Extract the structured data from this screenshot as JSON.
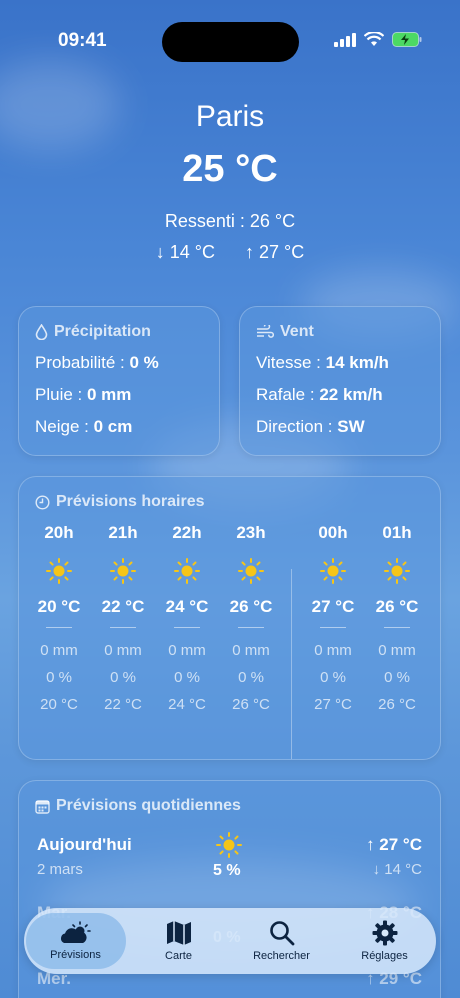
{
  "status": {
    "time": "09:41"
  },
  "header": {
    "city": "Paris",
    "temp": "25 °C",
    "feels": "Ressenti : 26 °C",
    "min": "↓ 14 °C",
    "max": "↑ 27 °C"
  },
  "precip": {
    "title": "Précipitation",
    "prob_label": "Probabilité : ",
    "prob_value": "0 %",
    "rain_label": "Pluie : ",
    "rain_value": "0 mm",
    "snow_label": "Neige : ",
    "snow_value": "0 cm"
  },
  "wind": {
    "title": "Vent",
    "speed_label": "Vitesse : ",
    "speed_value": "14 km/h",
    "gust_label": "Rafale : ",
    "gust_value": "22 km/h",
    "dir_label": "Direction : ",
    "dir_value": "SW"
  },
  "hourly": {
    "title": "Prévisions horaires",
    "items": [
      {
        "hour": "20h",
        "temp": "20 °C",
        "rain": "0 mm",
        "prob": "0 %",
        "feels": "20 °C"
      },
      {
        "hour": "21h",
        "temp": "22 °C",
        "rain": "0 mm",
        "prob": "0 %",
        "feels": "22 °C"
      },
      {
        "hour": "22h",
        "temp": "24 °C",
        "rain": "0 mm",
        "prob": "0 %",
        "feels": "24 °C"
      },
      {
        "hour": "23h",
        "temp": "26 °C",
        "rain": "0 mm",
        "prob": "0 %",
        "feels": "26 °C"
      },
      {
        "hour": "00h",
        "temp": "27 °C",
        "rain": "0 mm",
        "prob": "0 %",
        "feels": "27 °C"
      },
      {
        "hour": "01h",
        "temp": "26 °C",
        "rain": "0 mm",
        "prob": "0 %",
        "feels": "26 °C"
      }
    ]
  },
  "daily": {
    "title": "Prévisions quotidiennes",
    "items": [
      {
        "day": "Aujourd'hui",
        "date": "2 mars",
        "prob": "5 %",
        "max": "↑ 27 °C",
        "min": "↓ 14 °C"
      },
      {
        "day": "Mar.",
        "date": "",
        "prob": "0 %",
        "max": "↑ 28 °C",
        "min": ""
      },
      {
        "day": "Mer.",
        "date": "",
        "prob": "",
        "max": "↑ 29 °C",
        "min": ""
      }
    ]
  },
  "tabs": [
    {
      "label": "Prévisions"
    },
    {
      "label": "Carte"
    },
    {
      "label": "Rechercher"
    },
    {
      "label": "Réglages"
    }
  ],
  "colors": {
    "sun": "#f5c518",
    "accent": "#3a73c9"
  }
}
